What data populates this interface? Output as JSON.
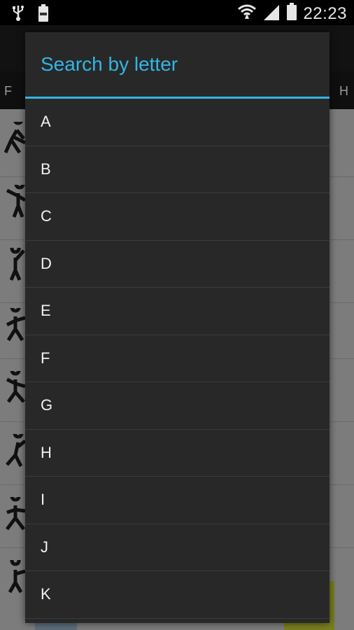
{
  "status_bar": {
    "time": "22:23",
    "icons": [
      "usb-icon",
      "battery-saver-icon",
      "wifi-icon",
      "signal-icon",
      "battery-icon"
    ]
  },
  "background_tabs": {
    "left_letter": "F",
    "right_letter": "H"
  },
  "dialog": {
    "title": "Search by letter",
    "accent_color": "#33b5e5",
    "items": [
      "A",
      "B",
      "C",
      "D",
      "E",
      "F",
      "G",
      "H",
      "I",
      "J",
      "K"
    ]
  }
}
